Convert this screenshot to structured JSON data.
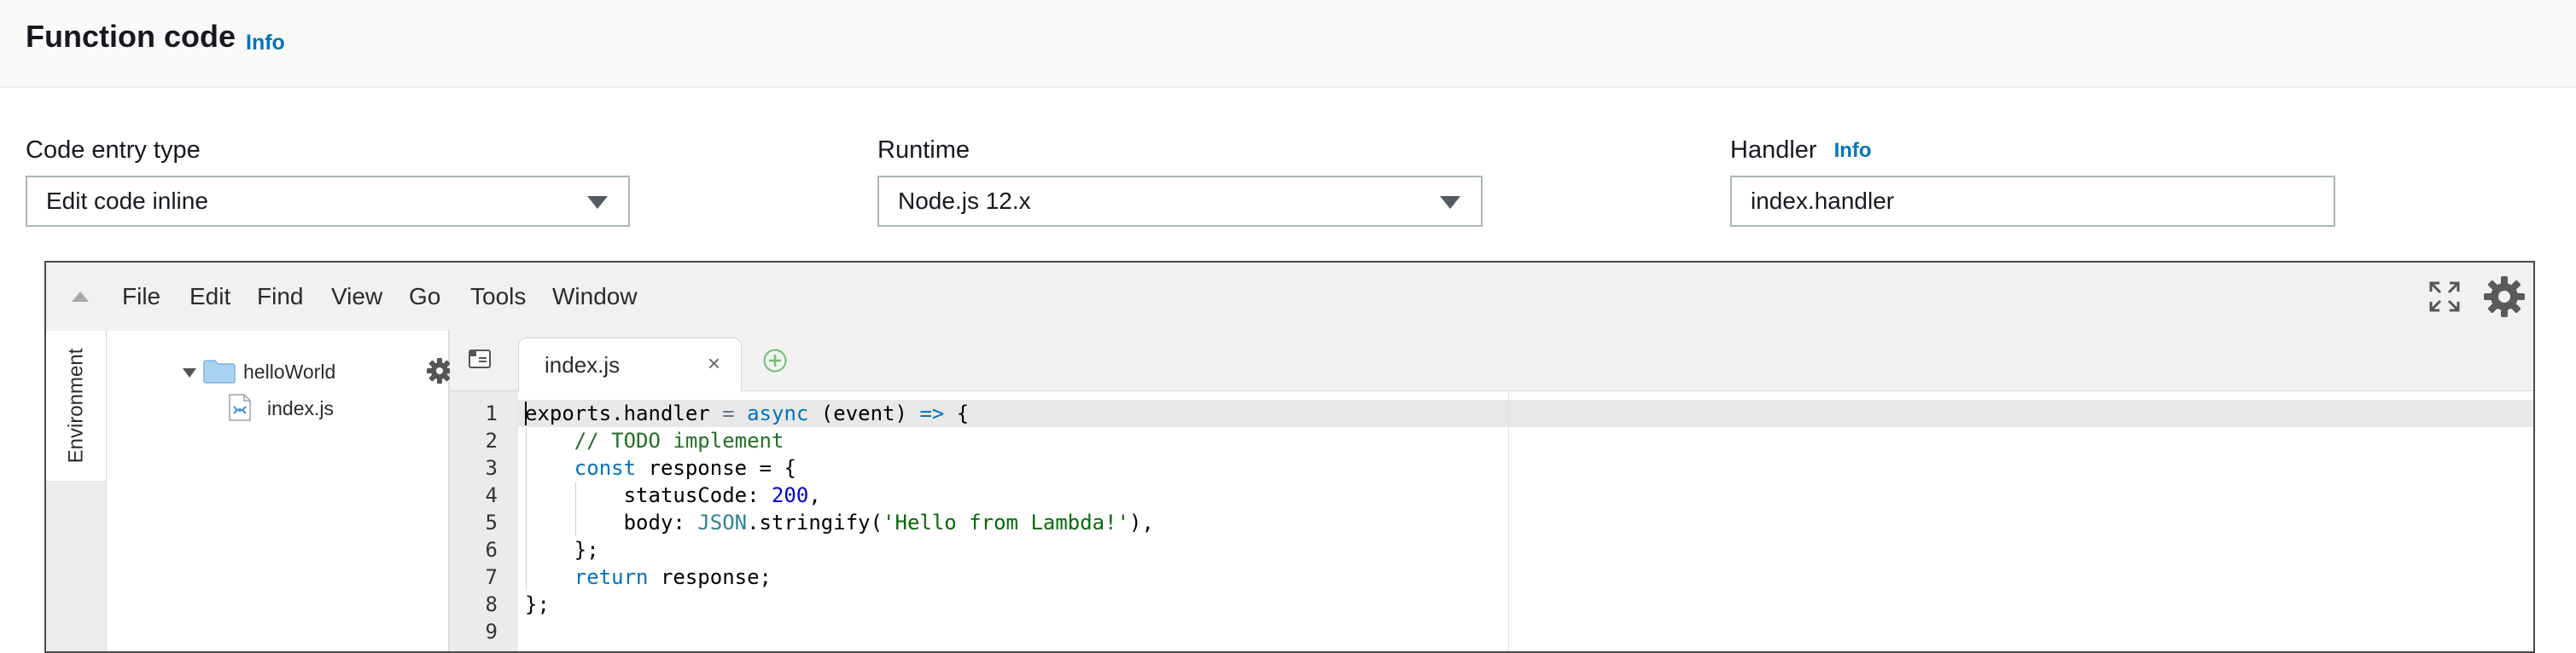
{
  "panel": {
    "title": "Function code",
    "info_label": "Info"
  },
  "form": {
    "code_entry_label": "Code entry type",
    "code_entry_value": "Edit code inline",
    "runtime_label": "Runtime",
    "runtime_value": "Node.js 12.x",
    "handler_label": "Handler",
    "handler_info": "Info",
    "handler_value": "index.handler"
  },
  "ide": {
    "menu": [
      "File",
      "Edit",
      "Find",
      "View",
      "Go",
      "Tools",
      "Window"
    ],
    "environment_tab": "Environment",
    "tree": {
      "folder": "helloWorld",
      "file": "index.js"
    },
    "tab": {
      "label": "index.js",
      "close": "×"
    },
    "line_numbers": [
      "1",
      "2",
      "3",
      "4",
      "5",
      "6",
      "7",
      "8",
      "9"
    ],
    "code": {
      "l1": {
        "a": "exports.handler",
        "b": " = ",
        "c": "async",
        "d": " (event) ",
        "e": "=>",
        "f": " {"
      },
      "l2": {
        "a": "    // TODO implement"
      },
      "l3": {
        "a": "    ",
        "b": "const",
        "c": " response = {"
      },
      "l4": {
        "a": "        statusCode: ",
        "b": "200",
        "c": ","
      },
      "l5": {
        "a": "        body: ",
        "b": "JSON",
        "c": ".stringify(",
        "d": "'Hello from Lambda!'",
        "e": "),"
      },
      "l6": {
        "a": "    };"
      },
      "l7": {
        "a": "    ",
        "b": "return",
        "c": " response;"
      },
      "l8": {
        "a": "};"
      },
      "l9": {
        "a": ""
      }
    }
  },
  "icons": {
    "collapse": "triangle-up-icon",
    "fullscreen": "expand-arrows-icon",
    "settings": "gear-icon",
    "folder": "folder-icon",
    "file": "js-file-icon",
    "add_tab": "plus-circle-icon",
    "tabs_menu": "tabs-menu-icon"
  },
  "colors": {
    "link": "#0073bb",
    "keyword": "#0073bb",
    "comment": "#236e24",
    "string": "#036a07",
    "number": "#0000cd"
  }
}
